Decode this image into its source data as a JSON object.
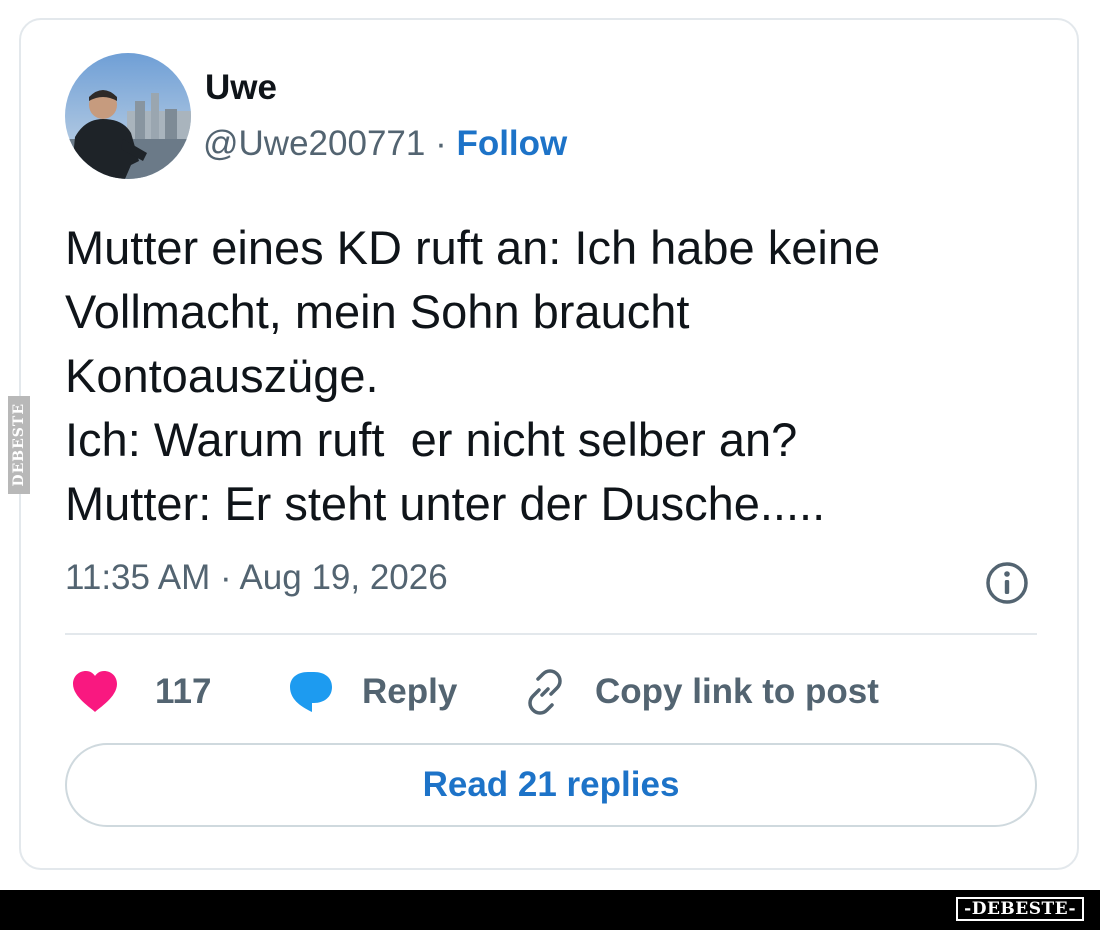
{
  "tweet": {
    "author_name": "Uwe",
    "handle": "@Uwe200771",
    "separator": " · ",
    "follow_label": "Follow",
    "text_lines": [
      "Mutter eines KD ruft an: Ich habe keine",
      "Vollmacht, mein Sohn braucht",
      "Kontoauszüge.",
      "Ich: Warum ruft  er nicht selber an?",
      "Mutter: Er steht unter der Dusche....."
    ],
    "timestamp": "11:35 AM · Aug 19, 2026"
  },
  "actions": {
    "like_count": "117",
    "reply_label": "Reply",
    "copy_label": "Copy link to post"
  },
  "read_replies_label": "Read 21 replies",
  "watermarks": {
    "side": "DEBESTE",
    "bottom": "-DEBESTE-"
  },
  "icons": {
    "like": "heart-icon",
    "reply": "speech-bubble-icon",
    "copy": "link-icon",
    "info": "info-icon"
  },
  "colors": {
    "link_blue": "#1d73c8",
    "heart_pink": "#f91880",
    "reply_blue": "#1d9bf0",
    "muted_text": "#536471"
  }
}
